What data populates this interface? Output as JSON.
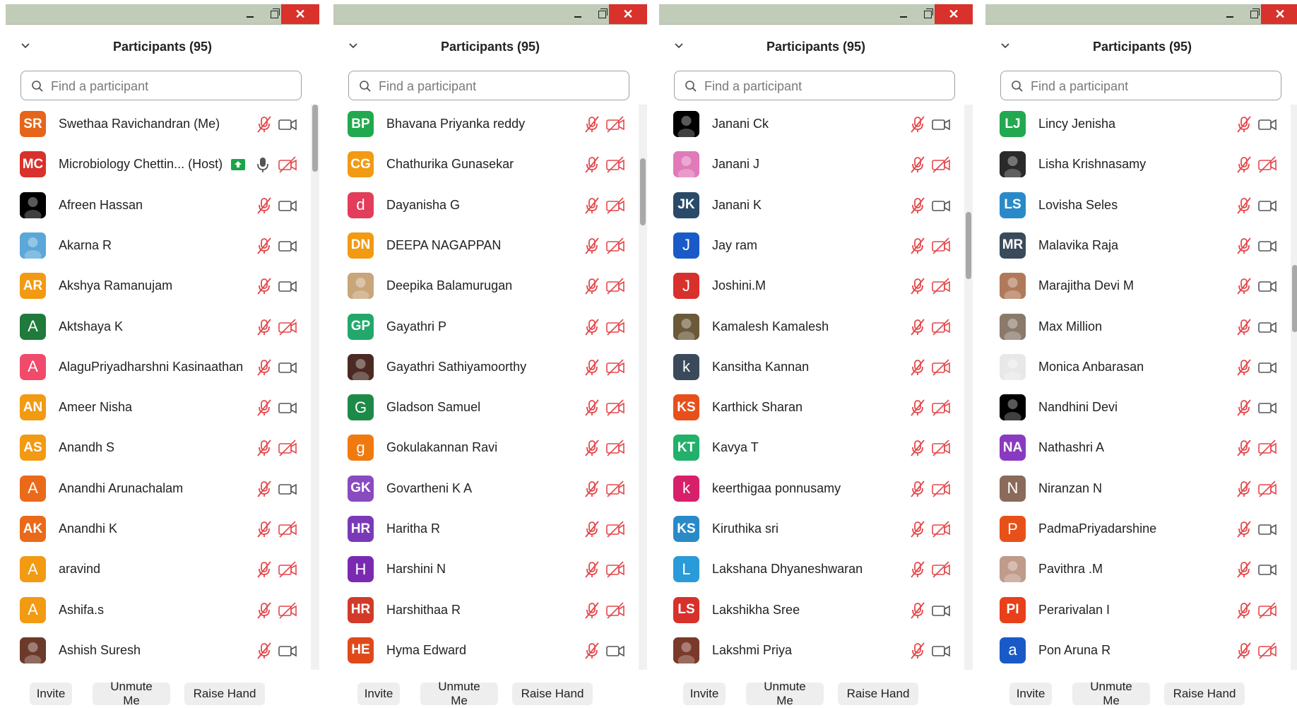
{
  "window": {
    "min_icon": "minimize-icon",
    "max_icon": "maximize-icon",
    "close_icon": "close-icon"
  },
  "panels": [
    {
      "title": "Participants (95)",
      "search_placeholder": "Find a participant",
      "footer": {
        "invite": "Invite",
        "unmute": "Unmute Me",
        "raise": "Raise Hand"
      },
      "scroll_fraction": 0.0,
      "participants": [
        {
          "initials": "SR",
          "name": "Swethaa Ravichandran (Me)",
          "color": "#e5651b",
          "cam": "on"
        },
        {
          "initials": "MC",
          "name": "Microbiology Chettin... (Host)",
          "color": "#d9312b",
          "cam": "off",
          "host": true
        },
        {
          "initials": "",
          "name": "Afreen Hassan",
          "color": "#000000",
          "cam": "on",
          "image": true
        },
        {
          "initials": "",
          "name": "Akarna R",
          "color": "#5aa7d8",
          "cam": "on",
          "image": true
        },
        {
          "initials": "AR",
          "name": "Akshya Ramanujam",
          "color": "#f29a12",
          "cam": "on"
        },
        {
          "initials": "A",
          "name": "Aktshaya K",
          "color": "#1f7a3b",
          "cam": "off"
        },
        {
          "initials": "A",
          "name": "AlaguPriyadharshni Kasinaathan",
          "color": "#f04b6a",
          "cam": "on"
        },
        {
          "initials": "AN",
          "name": "Ameer Nisha",
          "color": "#f29a12",
          "cam": "on"
        },
        {
          "initials": "AS",
          "name": "Anandh S",
          "color": "#f29a12",
          "cam": "off"
        },
        {
          "initials": "A",
          "name": "Anandhi Arunachalam",
          "color": "#ea6a1a",
          "cam": "on"
        },
        {
          "initials": "AK",
          "name": "Anandhi K",
          "color": "#ea6a1a",
          "cam": "off"
        },
        {
          "initials": "A",
          "name": "aravind",
          "color": "#f29a12",
          "cam": "off"
        },
        {
          "initials": "A",
          "name": "Ashifa.s",
          "color": "#f29a12",
          "cam": "off"
        },
        {
          "initials": "",
          "name": "Ashish Suresh",
          "color": "#6b3a2a",
          "cam": "on",
          "image": true
        }
      ]
    },
    {
      "title": "Participants (95)",
      "search_placeholder": "Find a participant",
      "footer": {
        "invite": "Invite",
        "unmute": "Unmute Me",
        "raise": "Raise Hand"
      },
      "scroll_fraction": 0.15,
      "participants": [
        {
          "initials": "BP",
          "name": "Bhavana Priyanka reddy",
          "color": "#22a84e",
          "cam": "off"
        },
        {
          "initials": "CG",
          "name": "Chathurika Gunasekar",
          "color": "#f29a12",
          "cam": "off"
        },
        {
          "initials": "d",
          "name": "Dayanisha G",
          "color": "#e23d5a",
          "cam": "off"
        },
        {
          "initials": "DN",
          "name": "DEEPA NAGAPPAN",
          "color": "#f29a12",
          "cam": "off"
        },
        {
          "initials": "",
          "name": "Deepika Balamurugan",
          "color": "#c9a57a",
          "cam": "off",
          "image": true
        },
        {
          "initials": "GP",
          "name": "Gayathri P",
          "color": "#22a86a",
          "cam": "off"
        },
        {
          "initials": "",
          "name": "Gayathri Sathiyamoorthy",
          "color": "#4a2a22",
          "cam": "off",
          "image": true
        },
        {
          "initials": "G",
          "name": "Gladson Samuel",
          "color": "#1e8a4a",
          "cam": "off"
        },
        {
          "initials": "g",
          "name": "Gokulakannan Ravi",
          "color": "#f07a10",
          "cam": "off"
        },
        {
          "initials": "GK",
          "name": "Govartheni K A",
          "color": "#8a4ac0",
          "cam": "off"
        },
        {
          "initials": "HR",
          "name": "Haritha R",
          "color": "#7a3ab8",
          "cam": "off"
        },
        {
          "initials": "H",
          "name": "Harshini N",
          "color": "#7a2ab0",
          "cam": "off"
        },
        {
          "initials": "HR",
          "name": "Harshithaa R",
          "color": "#d23a2a",
          "cam": "off"
        },
        {
          "initials": "HE",
          "name": "Hyma Edward",
          "color": "#e04a1a",
          "cam": "on"
        }
      ]
    },
    {
      "title": "Participants (95)",
      "search_placeholder": "Find a participant",
      "footer": {
        "invite": "Invite",
        "unmute": "Unmute Me",
        "raise": "Raise Hand"
      },
      "scroll_fraction": 0.3,
      "participants": [
        {
          "initials": "",
          "name": "Janani Ck",
          "color": "#000000",
          "cam": "on",
          "image": true
        },
        {
          "initials": "",
          "name": "Janani J",
          "color": "#e07ab8",
          "cam": "off",
          "image": true
        },
        {
          "initials": "JK",
          "name": "Janani K",
          "color": "#2a4a6a",
          "cam": "on"
        },
        {
          "initials": "J",
          "name": "Jay ram",
          "color": "#1a5ac8",
          "cam": "off"
        },
        {
          "initials": "J",
          "name": "Joshini.M",
          "color": "#d8302a",
          "cam": "off"
        },
        {
          "initials": "",
          "name": "Kamalesh Kamalesh",
          "color": "#6a5a3a",
          "cam": "off",
          "image": true
        },
        {
          "initials": "k",
          "name": "Kansitha Kannan",
          "color": "#3a4a5a",
          "cam": "off"
        },
        {
          "initials": "KS",
          "name": "Karthick Sharan",
          "color": "#e8501a",
          "cam": "off"
        },
        {
          "initials": "KT",
          "name": "Kavya T",
          "color": "#22b06a",
          "cam": "off"
        },
        {
          "initials": "k",
          "name": "keerthigaa ponnusamy",
          "color": "#d8206a",
          "cam": "off"
        },
        {
          "initials": "KS",
          "name": "Kiruthika sri",
          "color": "#2a8ac8",
          "cam": "off"
        },
        {
          "initials": "L",
          "name": "Lakshana Dhyaneshwaran",
          "color": "#2a9ad8",
          "cam": "off"
        },
        {
          "initials": "LS",
          "name": "Lakshikha Sree",
          "color": "#d8302a",
          "cam": "on"
        },
        {
          "initials": "",
          "name": "Lakshmi Priya",
          "color": "#7a3a2a",
          "cam": "on",
          "image": true
        }
      ]
    },
    {
      "title": "Participants (95)",
      "search_placeholder": "Find a participant",
      "footer": {
        "invite": "Invite",
        "unmute": "Unmute Me",
        "raise": "Raise Hand"
      },
      "scroll_fraction": 0.45,
      "participants": [
        {
          "initials": "LJ",
          "name": "Lincy Jenisha",
          "color": "#22a84e",
          "cam": "on"
        },
        {
          "initials": "",
          "name": "Lisha Krishnasamy",
          "color": "#2a2a2a",
          "cam": "off",
          "image": true
        },
        {
          "initials": "LS",
          "name": "Lovisha Seles",
          "color": "#2a8ac8",
          "cam": "on"
        },
        {
          "initials": "MR",
          "name": "Malavika Raja",
          "color": "#3a4a5a",
          "cam": "on"
        },
        {
          "initials": "",
          "name": "Marajitha Devi M",
          "color": "#b07a5a",
          "cam": "on",
          "image": true
        },
        {
          "initials": "",
          "name": "Max Million",
          "color": "#8a7a6a",
          "cam": "on",
          "image": true
        },
        {
          "initials": "",
          "name": "Monica Anbarasan",
          "color": "#e8e8e8",
          "cam": "on",
          "image": true
        },
        {
          "initials": "",
          "name": "Nandhini Devi",
          "color": "#000000",
          "cam": "on",
          "image": true
        },
        {
          "initials": "NA",
          "name": "Nathashri A",
          "color": "#8a3ac0",
          "cam": "off"
        },
        {
          "initials": "N",
          "name": "Niranzan N",
          "color": "#8a6a5a",
          "cam": "off"
        },
        {
          "initials": "P",
          "name": "PadmaPriyadarshine",
          "color": "#e8501a",
          "cam": "on"
        },
        {
          "initials": "",
          "name": "Pavithra .M",
          "color": "#c09a8a",
          "cam": "on",
          "image": true
        },
        {
          "initials": "PI",
          "name": "Perarivalan I",
          "color": "#e8401a",
          "cam": "off"
        },
        {
          "initials": "a",
          "name": "Pon Aruna R",
          "color": "#1a5ac8",
          "cam": "off"
        }
      ]
    }
  ]
}
